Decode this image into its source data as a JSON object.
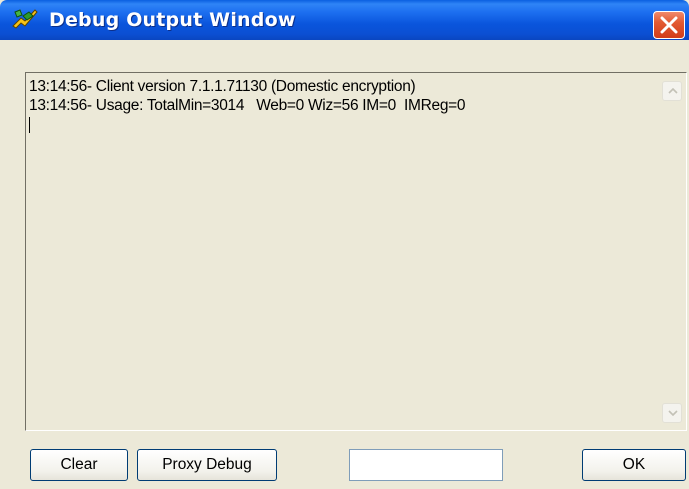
{
  "window": {
    "title": "Debug Output Window",
    "title_icon": "app-icon",
    "close_icon": "close-icon"
  },
  "output": {
    "lines": [
      "13:14:56- Client version 7.1.1.71130 (Domestic encryption)",
      "13:14:56- Usage: TotalMin=3014   Web=0 Wiz=56 IM=0  IMReg=0"
    ]
  },
  "buttons": {
    "clear": "Clear",
    "proxy_debug": "Proxy Debug",
    "ok": "OK"
  },
  "input": {
    "value": ""
  },
  "colors": {
    "titlebar": "#0a55dc",
    "close": "#d23d1a",
    "face": "#ece9d8"
  }
}
